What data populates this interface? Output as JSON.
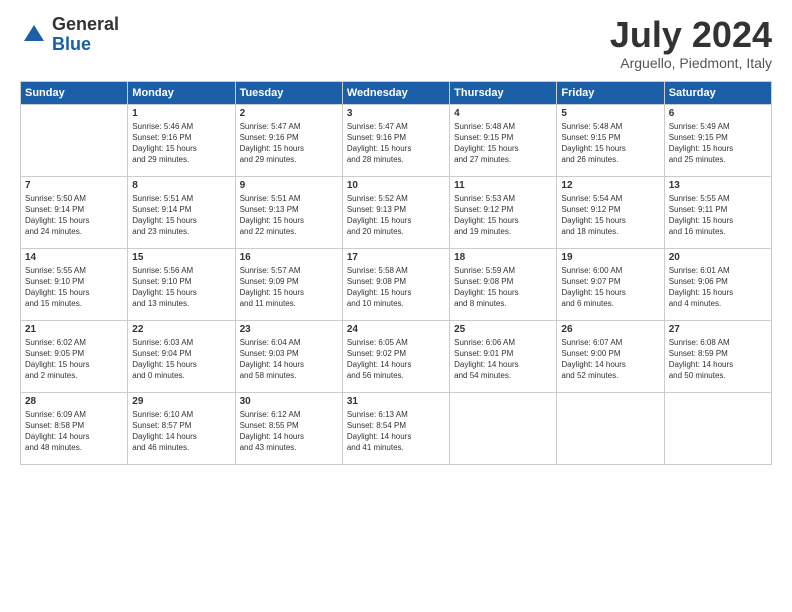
{
  "logo": {
    "general": "General",
    "blue": "Blue"
  },
  "title": "July 2024",
  "subtitle": "Arguello, Piedmont, Italy",
  "days_header": [
    "Sunday",
    "Monday",
    "Tuesday",
    "Wednesday",
    "Thursday",
    "Friday",
    "Saturday"
  ],
  "weeks": [
    [
      {
        "day": "",
        "sunrise": "",
        "sunset": "",
        "daylight": "",
        "empty": true
      },
      {
        "day": "1",
        "sunrise": "Sunrise: 5:46 AM",
        "sunset": "Sunset: 9:16 PM",
        "daylight": "Daylight: 15 hours and 29 minutes."
      },
      {
        "day": "2",
        "sunrise": "Sunrise: 5:47 AM",
        "sunset": "Sunset: 9:16 PM",
        "daylight": "Daylight: 15 hours and 29 minutes."
      },
      {
        "day": "3",
        "sunrise": "Sunrise: 5:47 AM",
        "sunset": "Sunset: 9:16 PM",
        "daylight": "Daylight: 15 hours and 28 minutes."
      },
      {
        "day": "4",
        "sunrise": "Sunrise: 5:48 AM",
        "sunset": "Sunset: 9:15 PM",
        "daylight": "Daylight: 15 hours and 27 minutes."
      },
      {
        "day": "5",
        "sunrise": "Sunrise: 5:48 AM",
        "sunset": "Sunset: 9:15 PM",
        "daylight": "Daylight: 15 hours and 26 minutes."
      },
      {
        "day": "6",
        "sunrise": "Sunrise: 5:49 AM",
        "sunset": "Sunset: 9:15 PM",
        "daylight": "Daylight: 15 hours and 25 minutes."
      }
    ],
    [
      {
        "day": "7",
        "sunrise": "Sunrise: 5:50 AM",
        "sunset": "Sunset: 9:14 PM",
        "daylight": "Daylight: 15 hours and 24 minutes."
      },
      {
        "day": "8",
        "sunrise": "Sunrise: 5:51 AM",
        "sunset": "Sunset: 9:14 PM",
        "daylight": "Daylight: 15 hours and 23 minutes."
      },
      {
        "day": "9",
        "sunrise": "Sunrise: 5:51 AM",
        "sunset": "Sunset: 9:13 PM",
        "daylight": "Daylight: 15 hours and 22 minutes."
      },
      {
        "day": "10",
        "sunrise": "Sunrise: 5:52 AM",
        "sunset": "Sunset: 9:13 PM",
        "daylight": "Daylight: 15 hours and 20 minutes."
      },
      {
        "day": "11",
        "sunrise": "Sunrise: 5:53 AM",
        "sunset": "Sunset: 9:12 PM",
        "daylight": "Daylight: 15 hours and 19 minutes."
      },
      {
        "day": "12",
        "sunrise": "Sunrise: 5:54 AM",
        "sunset": "Sunset: 9:12 PM",
        "daylight": "Daylight: 15 hours and 18 minutes."
      },
      {
        "day": "13",
        "sunrise": "Sunrise: 5:55 AM",
        "sunset": "Sunset: 9:11 PM",
        "daylight": "Daylight: 15 hours and 16 minutes."
      }
    ],
    [
      {
        "day": "14",
        "sunrise": "Sunrise: 5:55 AM",
        "sunset": "Sunset: 9:10 PM",
        "daylight": "Daylight: 15 hours and 15 minutes."
      },
      {
        "day": "15",
        "sunrise": "Sunrise: 5:56 AM",
        "sunset": "Sunset: 9:10 PM",
        "daylight": "Daylight: 15 hours and 13 minutes."
      },
      {
        "day": "16",
        "sunrise": "Sunrise: 5:57 AM",
        "sunset": "Sunset: 9:09 PM",
        "daylight": "Daylight: 15 hours and 11 minutes."
      },
      {
        "day": "17",
        "sunrise": "Sunrise: 5:58 AM",
        "sunset": "Sunset: 9:08 PM",
        "daylight": "Daylight: 15 hours and 10 minutes."
      },
      {
        "day": "18",
        "sunrise": "Sunrise: 5:59 AM",
        "sunset": "Sunset: 9:08 PM",
        "daylight": "Daylight: 15 hours and 8 minutes."
      },
      {
        "day": "19",
        "sunrise": "Sunrise: 6:00 AM",
        "sunset": "Sunset: 9:07 PM",
        "daylight": "Daylight: 15 hours and 6 minutes."
      },
      {
        "day": "20",
        "sunrise": "Sunrise: 6:01 AM",
        "sunset": "Sunset: 9:06 PM",
        "daylight": "Daylight: 15 hours and 4 minutes."
      }
    ],
    [
      {
        "day": "21",
        "sunrise": "Sunrise: 6:02 AM",
        "sunset": "Sunset: 9:05 PM",
        "daylight": "Daylight: 15 hours and 2 minutes."
      },
      {
        "day": "22",
        "sunrise": "Sunrise: 6:03 AM",
        "sunset": "Sunset: 9:04 PM",
        "daylight": "Daylight: 15 hours and 0 minutes."
      },
      {
        "day": "23",
        "sunrise": "Sunrise: 6:04 AM",
        "sunset": "Sunset: 9:03 PM",
        "daylight": "Daylight: 14 hours and 58 minutes."
      },
      {
        "day": "24",
        "sunrise": "Sunrise: 6:05 AM",
        "sunset": "Sunset: 9:02 PM",
        "daylight": "Daylight: 14 hours and 56 minutes."
      },
      {
        "day": "25",
        "sunrise": "Sunrise: 6:06 AM",
        "sunset": "Sunset: 9:01 PM",
        "daylight": "Daylight: 14 hours and 54 minutes."
      },
      {
        "day": "26",
        "sunrise": "Sunrise: 6:07 AM",
        "sunset": "Sunset: 9:00 PM",
        "daylight": "Daylight: 14 hours and 52 minutes."
      },
      {
        "day": "27",
        "sunrise": "Sunrise: 6:08 AM",
        "sunset": "Sunset: 8:59 PM",
        "daylight": "Daylight: 14 hours and 50 minutes."
      }
    ],
    [
      {
        "day": "28",
        "sunrise": "Sunrise: 6:09 AM",
        "sunset": "Sunset: 8:58 PM",
        "daylight": "Daylight: 14 hours and 48 minutes."
      },
      {
        "day": "29",
        "sunrise": "Sunrise: 6:10 AM",
        "sunset": "Sunset: 8:57 PM",
        "daylight": "Daylight: 14 hours and 46 minutes."
      },
      {
        "day": "30",
        "sunrise": "Sunrise: 6:12 AM",
        "sunset": "Sunset: 8:55 PM",
        "daylight": "Daylight: 14 hours and 43 minutes."
      },
      {
        "day": "31",
        "sunrise": "Sunrise: 6:13 AM",
        "sunset": "Sunset: 8:54 PM",
        "daylight": "Daylight: 14 hours and 41 minutes."
      },
      {
        "day": "",
        "sunrise": "",
        "sunset": "",
        "daylight": "",
        "empty": true
      },
      {
        "day": "",
        "sunrise": "",
        "sunset": "",
        "daylight": "",
        "empty": true
      },
      {
        "day": "",
        "sunrise": "",
        "sunset": "",
        "daylight": "",
        "empty": true
      }
    ]
  ]
}
